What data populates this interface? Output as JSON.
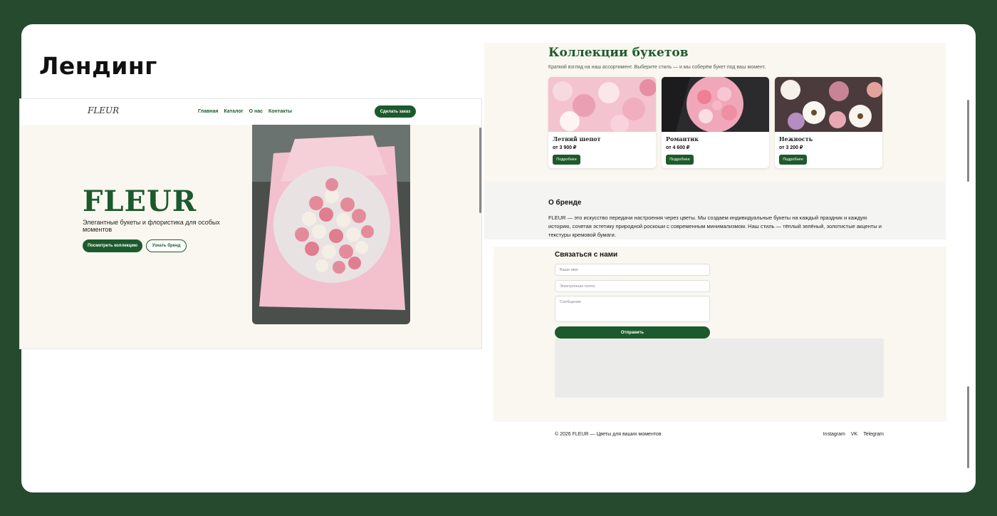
{
  "page": {
    "title": "Лендинг"
  },
  "hero": {
    "logo": "FLEUR",
    "nav": [
      "Главная",
      "Каталог",
      "О нас",
      "Контакты"
    ],
    "cta": "Сделать заказ",
    "title": "FLEUR",
    "subtitle": "Элегантные букеты и флористика для особых моментов",
    "primary_button": "Посмотреть коллекцию",
    "secondary_button": "Узнать бренд"
  },
  "collections": {
    "title": "Коллекции букетов",
    "subtitle": "Краткий взгляд на наш ассортимент. Выберите стиль — и мы соберём букет под ваш момент.",
    "items": [
      {
        "name": "Летний шепот",
        "price": "от 3 900 ₽",
        "button": "Подробнее"
      },
      {
        "name": "Романтик",
        "price": "от 4 600 ₽",
        "button": "Подробнее"
      },
      {
        "name": "Нежность",
        "price": "от 3 200 ₽",
        "button": "Подробнее"
      }
    ]
  },
  "about": {
    "title": "О бренде",
    "text": "FLEUR — это искусство передачи настроения через цветы. Мы создаем индивидуальные букеты на каждый праздник и каждую историю, сочетая эстетику природной роскоши с современным минимализмом. Наш стиль — тёплый зелёный, золотистые акценты и текстуры кремовой бумаги."
  },
  "contact": {
    "title": "Связаться с нами",
    "name_placeholder": "Ваше имя",
    "email_placeholder": "Электронная почта",
    "message_placeholder": "Сообщение",
    "submit": "Отправить"
  },
  "footer": {
    "copyright": "© 2026 FLEUR — Цветы для ваших моментов",
    "links": [
      "Instagram",
      "VK",
      "Telegram"
    ]
  },
  "colors": {
    "background": "#264a2e",
    "accent": "#1c5a2d",
    "cream": "#f9f7f0"
  }
}
